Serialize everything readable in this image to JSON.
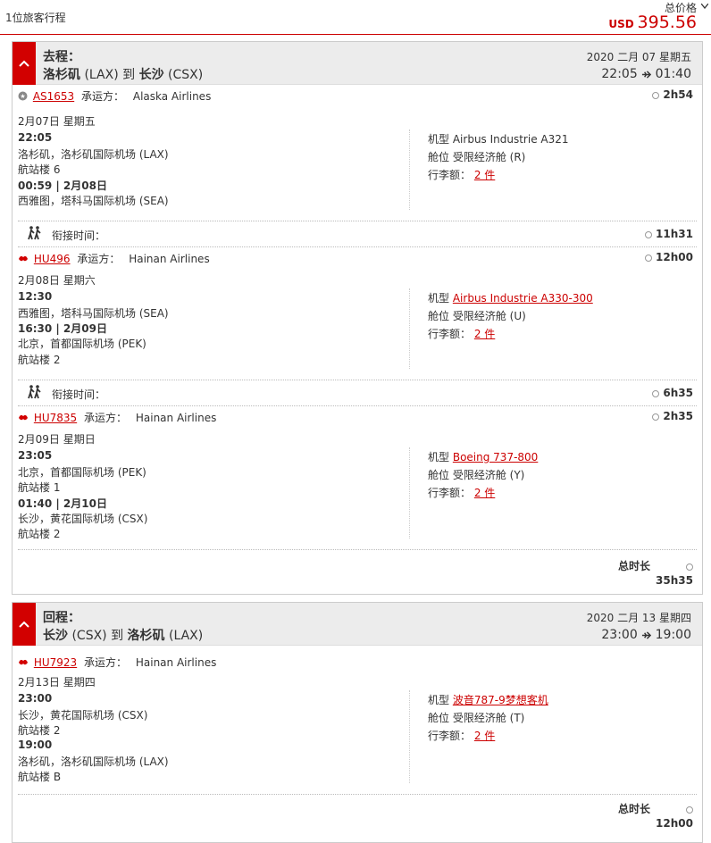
{
  "header": {
    "travelers": "1位旅客行程",
    "price_label": "总价格",
    "currency": "USD",
    "amount": "395.56"
  },
  "outbound": {
    "direction": "去程：",
    "origin_city": "洛杉矶",
    "origin_code": "(LAX)",
    "to": "到",
    "dest_city": "长沙",
    "dest_code": "(CSX)",
    "date": "2020 二月 07 星期五",
    "depart": "22:05",
    "arrive": "01:40",
    "segments": [
      {
        "flight_no": "AS1653",
        "carrier_label": "承运方：",
        "carrier": "Alaska Airlines",
        "duration": "2h54",
        "date": "2月07日 星期五",
        "dep_time": "22:05",
        "dep_airport": "洛杉矶，洛杉矶国际机场 (LAX)",
        "dep_terminal": "航站楼 6",
        "arr_time": "00:59 | 2月08日",
        "arr_airport": "西雅图，塔科马国际机场 (SEA)",
        "aircraft_label": "机型",
        "aircraft": "Airbus Industrie A321",
        "cabin_label": "舱位",
        "cabin": "受限经济舱 (R)",
        "baggage_label": "行李额：",
        "baggage": "2 件"
      },
      {
        "flight_no": "HU496",
        "carrier_label": "承运方：",
        "carrier": "Hainan Airlines",
        "duration": "12h00",
        "date": "2月08日 星期六",
        "dep_time": "12:30",
        "dep_airport": "西雅图，塔科马国际机场 (SEA)",
        "arr_time": "16:30 | 2月09日",
        "arr_airport": "北京，首都国际机场 (PEK)",
        "arr_terminal": "航站楼 2",
        "aircraft_label": "机型",
        "aircraft": "Airbus Industrie A330-300",
        "cabin_label": "舱位",
        "cabin": "受限经济舱 (U)",
        "baggage_label": "行李额：",
        "baggage": "2 件"
      },
      {
        "flight_no": "HU7835",
        "carrier_label": "承运方：",
        "carrier": "Hainan Airlines",
        "duration": "2h35",
        "date": "2月09日 星期日",
        "dep_time": "23:05",
        "dep_airport": "北京，首都国际机场 (PEK)",
        "dep_terminal": "航站楼 1",
        "arr_time": "01:40 | 2月10日",
        "arr_airport": "长沙，黄花国际机场 (CSX)",
        "arr_terminal": "航站楼 2",
        "aircraft_label": "机型",
        "aircraft": "Boeing 737-800",
        "cabin_label": "舱位",
        "cabin": "受限经济舱 (Y)",
        "baggage_label": "行李额：",
        "baggage": "2 件"
      }
    ],
    "connections": [
      {
        "label": "衔接时间：",
        "time": "11h31"
      },
      {
        "label": "衔接时间：",
        "time": "6h35"
      }
    ],
    "total_label": "总时长",
    "total": "35h35"
  },
  "return": {
    "direction": "回程：",
    "origin_city": "长沙",
    "origin_code": "(CSX)",
    "to": "到",
    "dest_city": "洛杉矶",
    "dest_code": "(LAX)",
    "date": "2020 二月 13 星期四",
    "depart": "23:00",
    "arrive": "19:00",
    "segments": [
      {
        "flight_no": "HU7923",
        "carrier_label": "承运方：",
        "carrier": "Hainan Airlines",
        "date": "2月13日 星期四",
        "dep_time": "23:00",
        "dep_airport": "长沙，黄花国际机场 (CSX)",
        "dep_terminal": "航站楼 2",
        "arr_time": "19:00",
        "arr_airport": "洛杉矶，洛杉矶国际机场 (LAX)",
        "arr_terminal": "航站楼 B",
        "aircraft_label": "机型",
        "aircraft": "波音787-9梦想客机",
        "cabin_label": "舱位",
        "cabin": "受限经济舱 (T)",
        "baggage_label": "行李额：",
        "baggage": "2 件"
      }
    ],
    "total_label": "总时长",
    "total": "12h00"
  }
}
